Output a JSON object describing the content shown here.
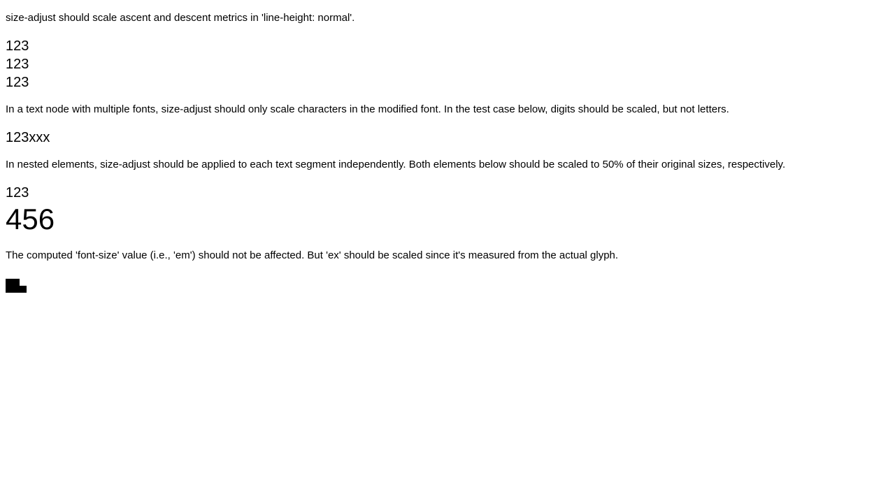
{
  "sections": {
    "line_height": {
      "description": "size-adjust should scale ascent and descent metrics in 'line-height: normal'.",
      "samples": [
        "123",
        "123",
        "123"
      ]
    },
    "multiple_fonts": {
      "description": "In a text node with multiple fonts, size-adjust should only scale characters in the modified font. In the test case below, digits should be scaled, but not letters.",
      "sample": "123xxx"
    },
    "nested": {
      "description": "In nested elements, size-adjust should be applied to each text segment independently. Both elements below should be scaled to 50% of their original sizes, respectively.",
      "outer_sample": "123",
      "inner_sample": "456"
    },
    "units": {
      "description": "The computed 'font-size' value (i.e., 'em') should not be affected. But 'ex' should be scaled since it's measured from the actual glyph."
    }
  }
}
